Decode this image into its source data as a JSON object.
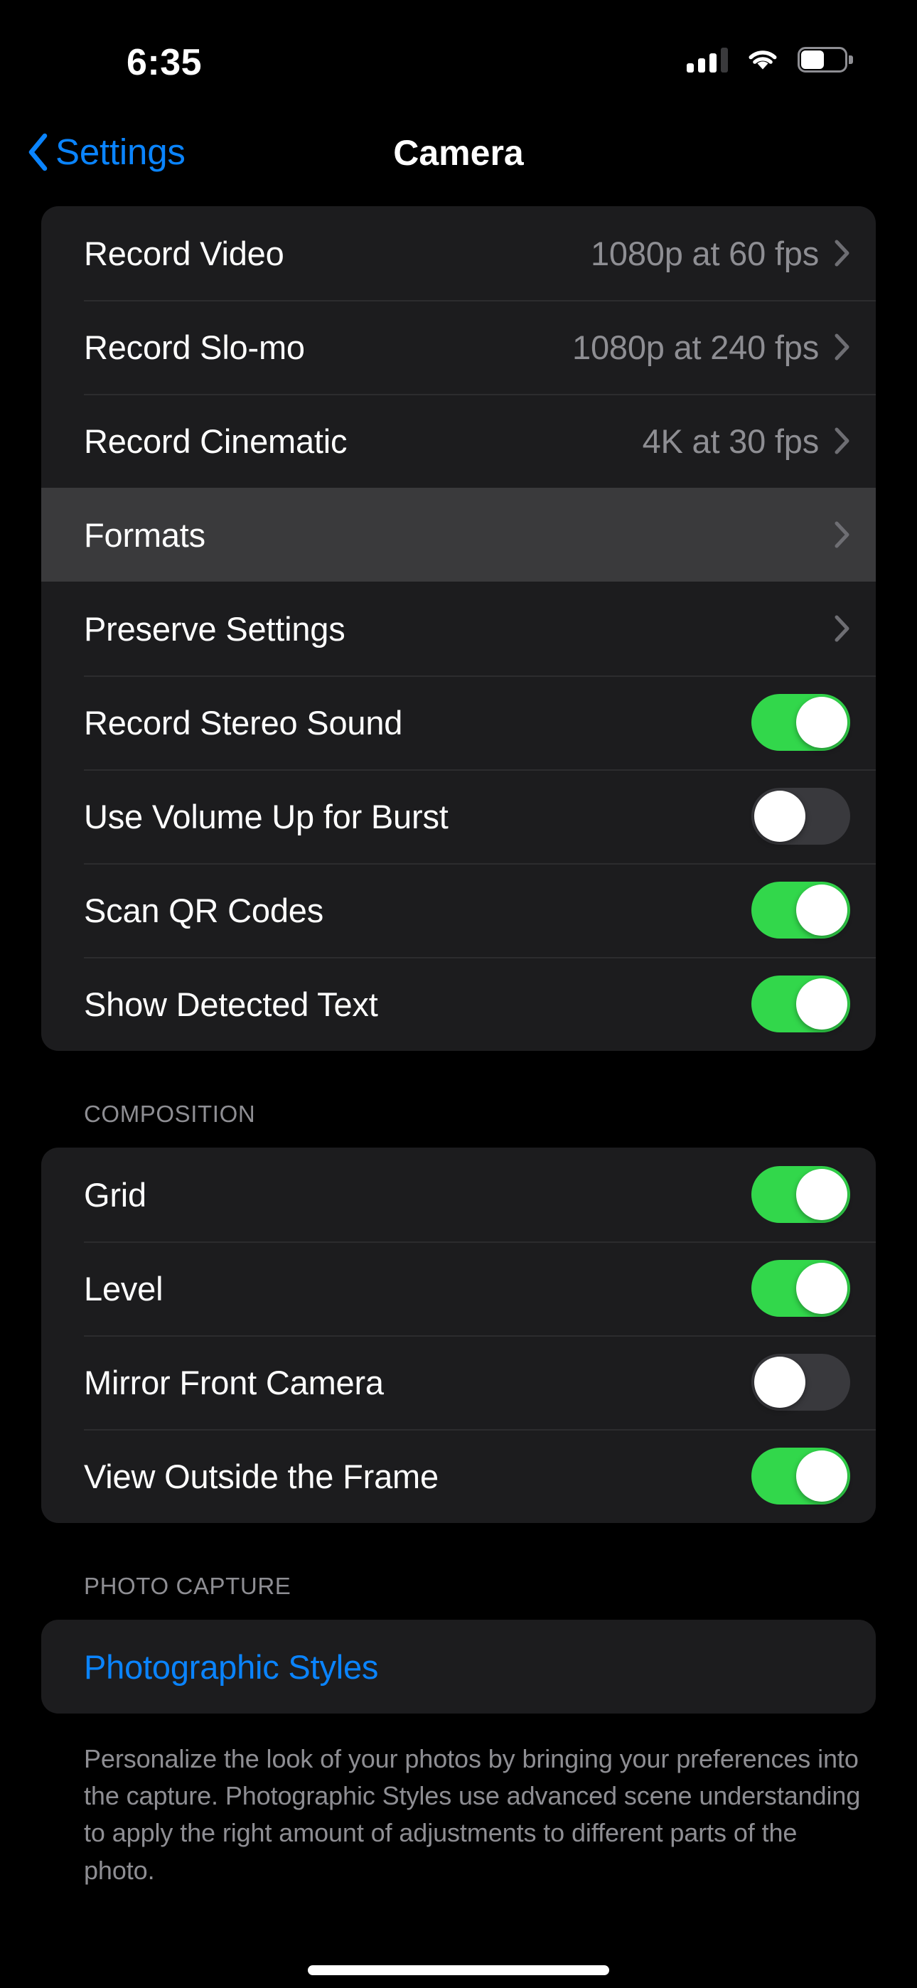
{
  "status_bar": {
    "time": "6:35",
    "cellular_icon": "cellular-signal-icon",
    "cellular_bars_filled": 3,
    "cellular_bars_total": 4,
    "wifi_icon": "wifi-icon",
    "battery_icon": "battery-icon",
    "battery_level_percent": 55
  },
  "nav": {
    "back_icon": "chevron-left-icon",
    "back_label": "Settings",
    "title": "Camera"
  },
  "colors": {
    "accent_blue": "#0a84ff",
    "toggle_on_green": "#32d74b",
    "toggle_off_gray": "#39393d",
    "card_background": "#1c1c1e",
    "pressed_highlight": "#3a3a3c",
    "secondary_text": "#8e8e93",
    "page_background": "#000000"
  },
  "groups": [
    {
      "name": "video-settings-group",
      "header": "",
      "footer": "",
      "rows": [
        {
          "name": "row-record-video",
          "label": "Record Video",
          "type": "disclosure",
          "value": "1080p at 60 fps",
          "chevron_icon": "chevron-right-icon",
          "pressed": false
        },
        {
          "name": "row-record-slo-mo",
          "label": "Record Slo-mo",
          "type": "disclosure",
          "value": "1080p at 240 fps",
          "chevron_icon": "chevron-right-icon",
          "pressed": false
        },
        {
          "name": "row-record-cinematic",
          "label": "Record Cinematic",
          "type": "disclosure",
          "value": "4K at 30 fps",
          "chevron_icon": "chevron-right-icon",
          "pressed": false
        },
        {
          "name": "row-formats",
          "label": "Formats",
          "type": "disclosure",
          "value": "",
          "chevron_icon": "chevron-right-icon",
          "pressed": true
        },
        {
          "name": "row-preserve-settings",
          "label": "Preserve Settings",
          "type": "disclosure",
          "value": "",
          "chevron_icon": "chevron-right-icon",
          "pressed": false
        },
        {
          "name": "row-record-stereo-sound",
          "label": "Record Stereo Sound",
          "type": "toggle",
          "toggle_on": true,
          "pressed": false
        },
        {
          "name": "row-use-volume-up-for-burst",
          "label": "Use Volume Up for Burst",
          "type": "toggle",
          "toggle_on": false,
          "pressed": false
        },
        {
          "name": "row-scan-qr-codes",
          "label": "Scan QR Codes",
          "type": "toggle",
          "toggle_on": true,
          "pressed": false
        },
        {
          "name": "row-show-detected-text",
          "label": "Show Detected Text",
          "type": "toggle",
          "toggle_on": true,
          "pressed": false
        }
      ]
    },
    {
      "name": "composition-group",
      "header": "COMPOSITION",
      "footer": "",
      "rows": [
        {
          "name": "row-grid",
          "label": "Grid",
          "type": "toggle",
          "toggle_on": true,
          "pressed": false
        },
        {
          "name": "row-level",
          "label": "Level",
          "type": "toggle",
          "toggle_on": true,
          "pressed": false
        },
        {
          "name": "row-mirror-front-camera",
          "label": "Mirror Front Camera",
          "type": "toggle",
          "toggle_on": false,
          "pressed": false
        },
        {
          "name": "row-view-outside-the-frame",
          "label": "View Outside the Frame",
          "type": "toggle",
          "toggle_on": true,
          "pressed": false
        }
      ]
    },
    {
      "name": "photo-capture-group",
      "header": "PHOTO CAPTURE",
      "footer": "Personalize the look of your photos by bringing your preferences into the capture. Photographic Styles use advanced scene understanding to apply the right amount of adjustments to different parts of the photo.",
      "rows": [
        {
          "name": "row-photographic-styles",
          "label": "Photographic Styles",
          "type": "plain",
          "accent": true,
          "pressed": false
        }
      ]
    }
  ],
  "home_indicator": "home-indicator"
}
